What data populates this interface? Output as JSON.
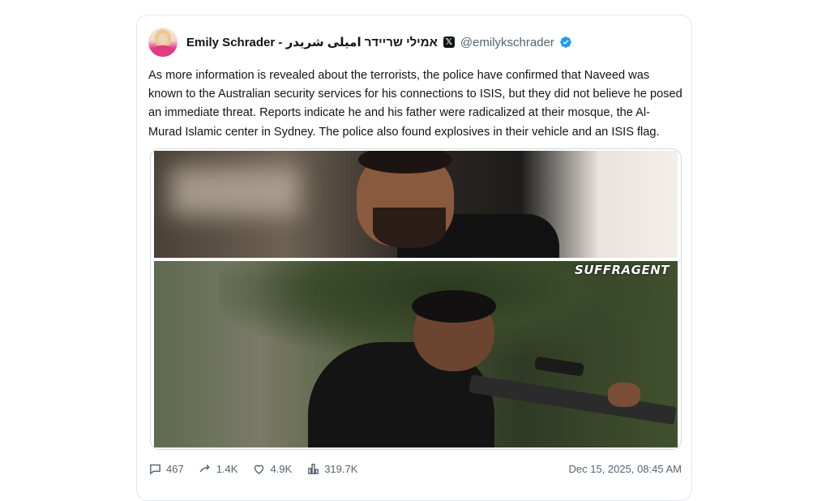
{
  "tweet": {
    "author_name": "Emily Schrader - אמילי שריידר اميلى شريدر",
    "platform_badge": "𝕏",
    "handle": "@emilykschrader",
    "text": "As more information is revealed about the terrorists, the police have confirmed that Naveed was known to the Australian security services for his connections to ISIS, but they did not believe he posed an immediate threat. Reports indicate he and his father were radicalized at their mosque, the Al-Murad Islamic center in Sydney. The police also found explosives in their vehicle and an ISIS flag.",
    "media_watermark": "SUFFRAGENT",
    "stats": {
      "replies": "467",
      "retweets": "1.4K",
      "likes": "4.9K",
      "views": "319.7K"
    },
    "timestamp": "Dec 15, 2025, 08:45 AM"
  },
  "colors": {
    "verified": "#1d9bf0",
    "muted": "#536471"
  },
  "icons": [
    "avatar",
    "x-logo-icon",
    "verified-badge-icon",
    "reply-icon",
    "retweet-icon",
    "like-icon",
    "views-icon"
  ]
}
